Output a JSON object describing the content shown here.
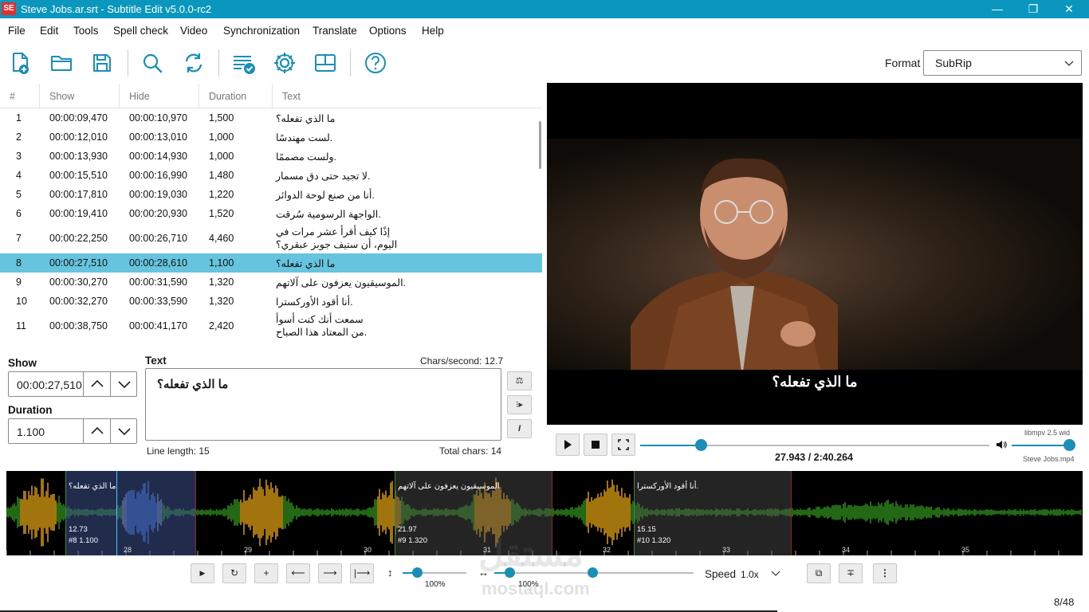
{
  "window": {
    "title": "Steve Jobs.ar.srt - Subtitle Edit v5.0.0-rc2",
    "app_icon_text": "SE",
    "minimize": "—",
    "restore": "❐",
    "close": "✕"
  },
  "menu": [
    "File",
    "Edit",
    "Tools",
    "Spell check",
    "Video",
    "Synchronization",
    "Translate",
    "Options",
    "Help"
  ],
  "toolbar": {
    "icons": [
      "new-file-icon",
      "open-folder-icon",
      "save-icon",
      "find-icon",
      "replace-icon",
      "fix-common-errors-icon",
      "settings-icon",
      "layout-icon",
      "help-icon"
    ],
    "format_label": "Format",
    "format_value": "SubRip"
  },
  "grid": {
    "columns": [
      "#",
      "Show",
      "Hide",
      "Duration",
      "Text"
    ],
    "rows": [
      {
        "num": "1",
        "show": "00:00:09,470",
        "hide": "00:00:10,970",
        "duration": "1,500",
        "text": [
          "ما الذي تفعله؟"
        ]
      },
      {
        "num": "2",
        "show": "00:00:12,010",
        "hide": "00:00:13,010",
        "duration": "1,000",
        "text": [
          ".لست مهندسًا"
        ]
      },
      {
        "num": "3",
        "show": "00:00:13,930",
        "hide": "00:00:14,930",
        "duration": "1,000",
        "text": [
          ".ولست مصممًا"
        ]
      },
      {
        "num": "4",
        "show": "00:00:15,510",
        "hide": "00:00:16,990",
        "duration": "1,480",
        "text": [
          ".لا تجيد حتى دق مسمار"
        ]
      },
      {
        "num": "5",
        "show": "00:00:17,810",
        "hide": "00:00:19,030",
        "duration": "1,220",
        "text": [
          ".أنا من صنع لوحة الدوائر"
        ]
      },
      {
        "num": "6",
        "show": "00:00:19,410",
        "hide": "00:00:20,930",
        "duration": "1,520",
        "text": [
          ".الواجهة الرسومية سُرقت"
        ]
      },
      {
        "num": "7",
        "show": "00:00:22,250",
        "hide": "00:00:26,710",
        "duration": "4,460",
        "text": [
          "إذًا كيف أقرأ عشر مرات في",
          "اليوم، أن ستيف جوبز عبقري؟"
        ]
      },
      {
        "num": "8",
        "show": "00:00:27,510",
        "hide": "00:00:28,610",
        "duration": "1,100",
        "text": [
          "ما الذي تفعله؟"
        ]
      },
      {
        "num": "9",
        "show": "00:00:30,270",
        "hide": "00:00:31,590",
        "duration": "1,320",
        "text": [
          ".الموسيقيون يعزفون على آلاتهم"
        ]
      },
      {
        "num": "10",
        "show": "00:00:32,270",
        "hide": "00:00:33,590",
        "duration": "1,320",
        "text": [
          ".أنا أقود الأوركسترا"
        ]
      },
      {
        "num": "11",
        "show": "00:00:38,750",
        "hide": "00:00:41,170",
        "duration": "2,420",
        "text": [
          "سمعت أنك كنت أسوأ",
          ".من المعتاد هذا الصباح"
        ]
      }
    ],
    "selected_index": 7
  },
  "editor": {
    "show_label": "Show",
    "show_value": "00:00:27,510",
    "duration_label": "Duration",
    "duration_value": "1.100",
    "text_label": "Text",
    "chars_per_second": "Chars/second: 12.7",
    "text_value": "ما الذي تفعله؟",
    "line_length": "Line length:  15",
    "total_chars": "Total chars: 14",
    "side_buttons": [
      "⚖",
      "⁝▸",
      "I"
    ]
  },
  "video": {
    "subtitle": "ما الذي تفعله؟",
    "engine": "libmpv 2.5 wid",
    "time": "27.943 / 2:40.264",
    "file": "Steve Jobs.mp4",
    "position_fraction": 0.174,
    "volume_fraction": 0.9
  },
  "waveform": {
    "paragraphs": [
      {
        "text": "ما الذي تفعله؟",
        "start": "12.73",
        "info": "#8  1.100",
        "selected": true
      },
      {
        "text": ".الموسيقيون يعزفون على آلاتهم",
        "start": "21.97",
        "info": "#9  1.320",
        "selected": false
      },
      {
        "text": ".أنا أقود الأوركسترا",
        "start": "15.15",
        "info": "#10  1.320",
        "selected": false
      }
    ],
    "ticks": [
      "28",
      "29",
      "30",
      "31",
      "32",
      "33",
      "34",
      "35"
    ]
  },
  "wave_controls": {
    "buttons": [
      "▶",
      "↻",
      "+",
      "⟵",
      "⟶",
      "|⟶"
    ],
    "vertical_zoom_icon": "↕",
    "vertical_zoom": "100%",
    "horizontal_zoom_icon": "↔",
    "horizontal_zoom": "100%",
    "speed_label": "Speed",
    "speed_value": "1.0x",
    "right_buttons": [
      "⧉",
      "∓",
      "⋮"
    ]
  },
  "status": {
    "counter": "8/48"
  },
  "watermark": {
    "text": "مستقل",
    "sub": "mostaql.com"
  }
}
